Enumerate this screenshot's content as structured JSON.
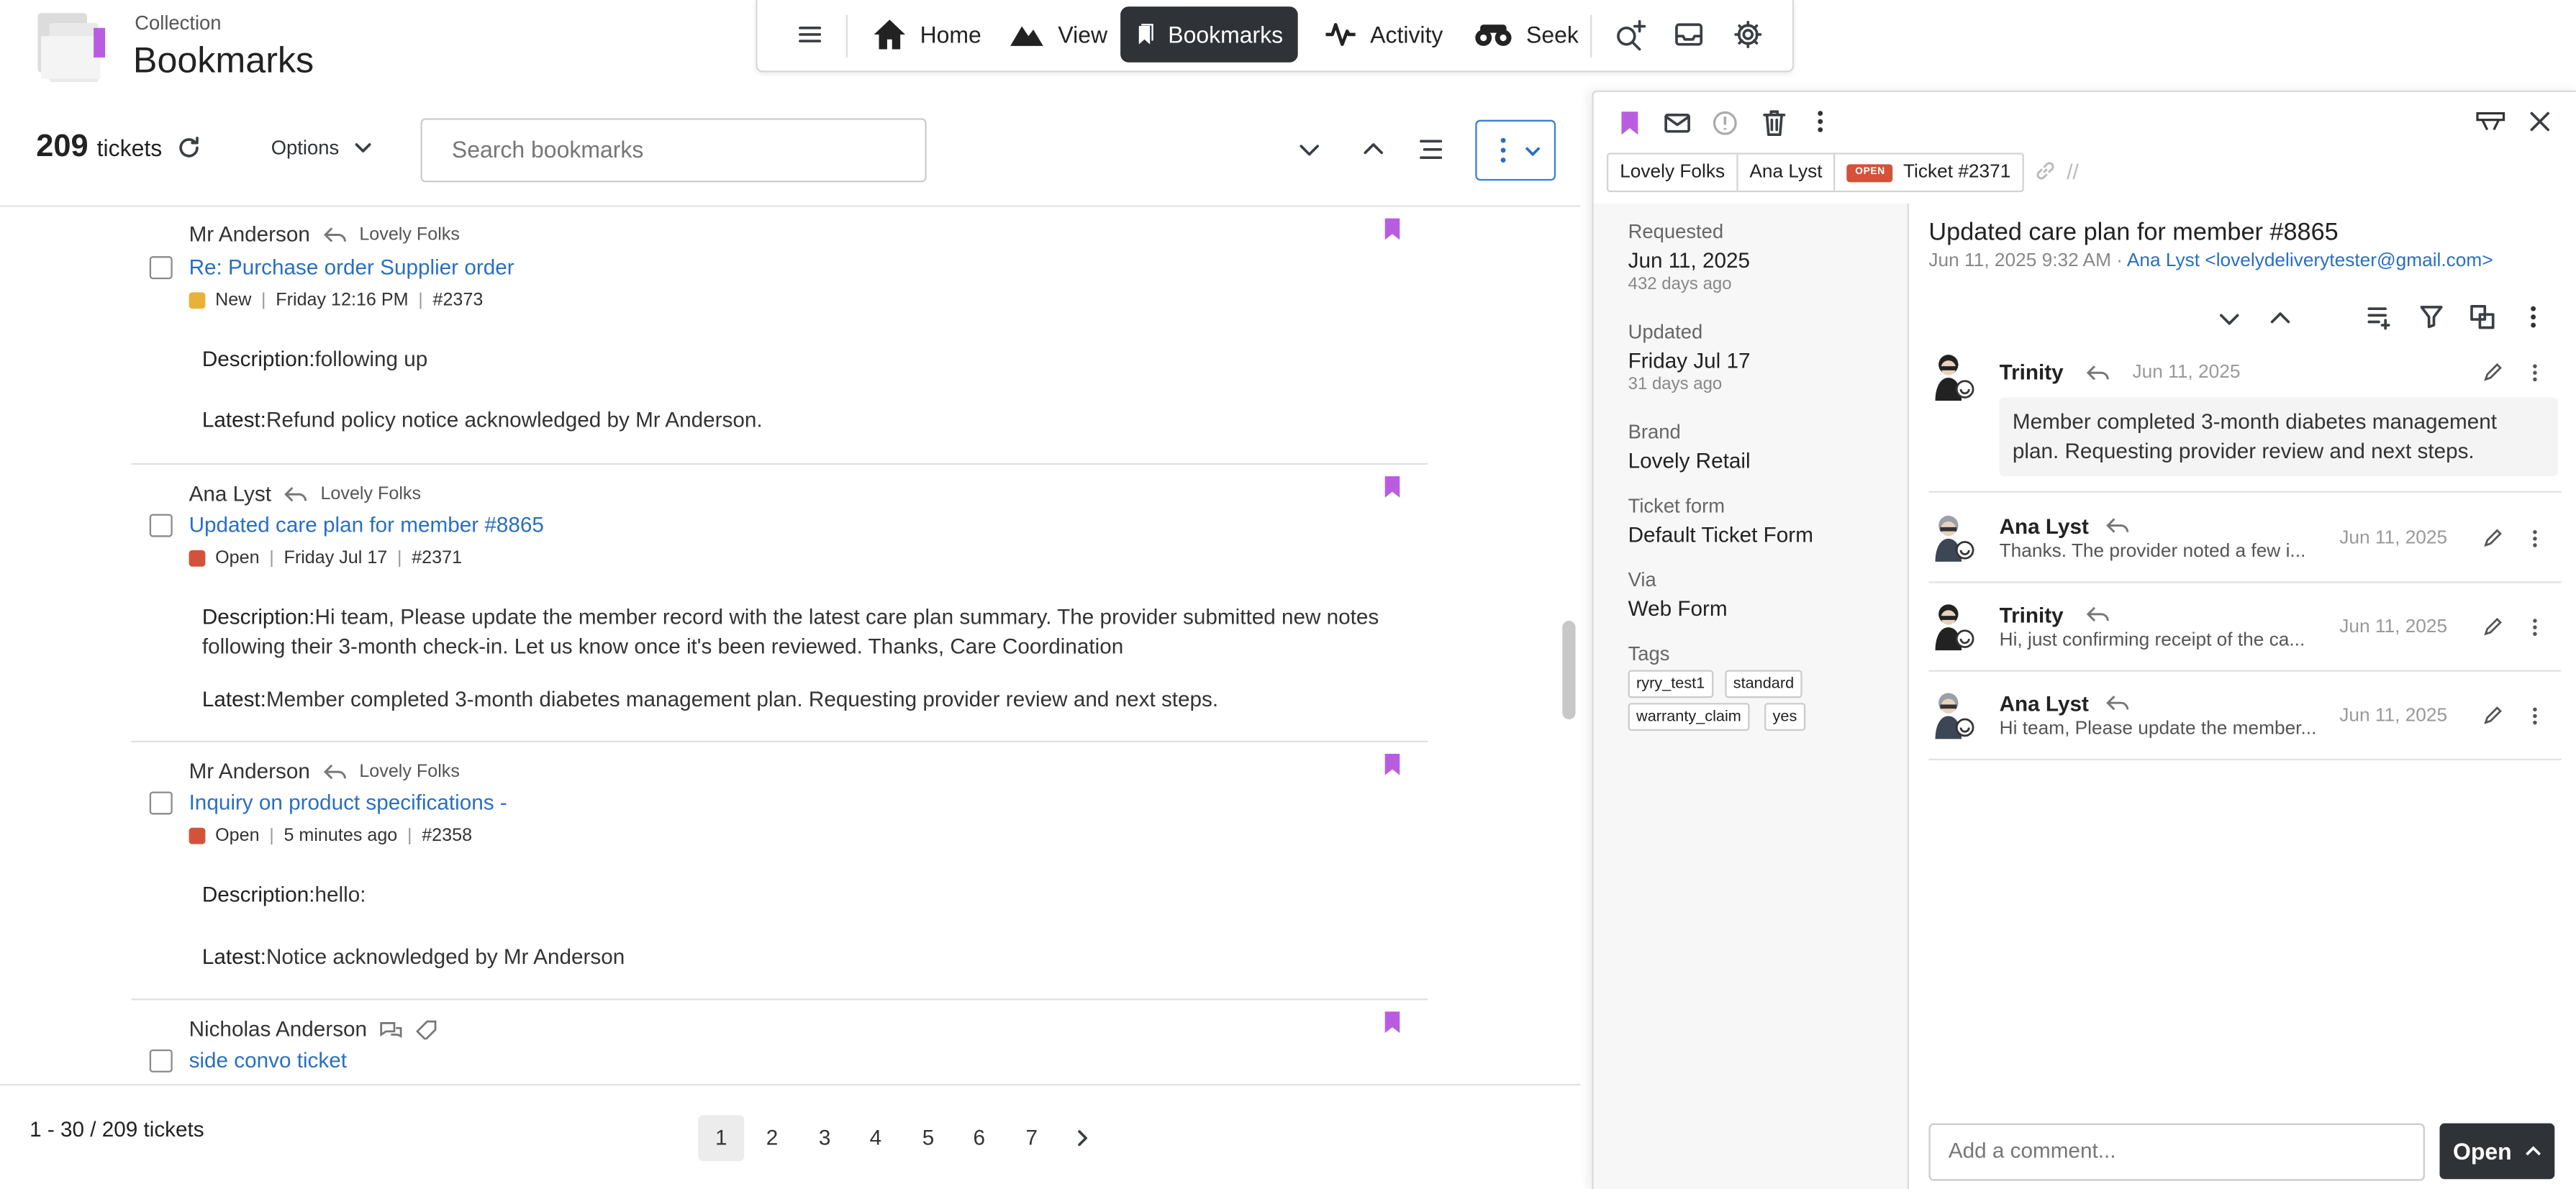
{
  "header": {
    "subtitle": "Collection",
    "title": "Bookmarks"
  },
  "nav": {
    "items": [
      {
        "label": "Home",
        "icon": "home-icon"
      },
      {
        "label": "View",
        "icon": "view-icon"
      },
      {
        "label": "Bookmarks",
        "icon": "bookmarks-icon",
        "active": true
      },
      {
        "label": "Activity",
        "icon": "activity-icon"
      },
      {
        "label": "Seek",
        "icon": "binoculars-icon"
      }
    ]
  },
  "toolbar": {
    "count": "209",
    "count_label": "tickets",
    "options_label": "Options",
    "search_placeholder": "Search bookmarks"
  },
  "tickets": [
    {
      "requester": "Mr Anderson",
      "org": "Lovely Folks",
      "subject": "Re: Purchase order Supplier order",
      "status": "New",
      "status_color": "#e8b23a",
      "date": "Friday 12:16 PM",
      "id": "#2373",
      "desc_label": "Description:",
      "description": "following up",
      "latest_label": "Latest:",
      "latest": "Refund policy notice acknowledged by Mr Anderson."
    },
    {
      "requester": "Ana Lyst",
      "org": "Lovely Folks",
      "subject": "Updated care plan for member #8865",
      "status": "Open",
      "status_color": "#d2533a",
      "date": "Friday Jul 17",
      "id": "#2371",
      "desc_label": "Description:",
      "description": "Hi team, Please update the member record with the latest care plan summary. The provider submitted new notes following their 3-month check-in. Let us know once it's been reviewed. Thanks, Care Coordination",
      "latest_label": "Latest:",
      "latest": "Member completed 3-month diabetes management plan. Requesting provider review and next steps."
    },
    {
      "requester": "Mr Anderson",
      "org": "Lovely Folks",
      "subject": "Inquiry on product specifications -",
      "status": "Open",
      "status_color": "#d2533a",
      "date": "5 minutes ago",
      "id": "#2358",
      "desc_label": "Description:",
      "description": "hello:",
      "latest_label": "Latest:",
      "latest": "Notice acknowledged by Mr Anderson"
    },
    {
      "requester": "Nicholas Anderson",
      "subject": "side convo ticket"
    }
  ],
  "footer": {
    "range": "1 - 30 / 209 tickets",
    "pages": [
      "1",
      "2",
      "3",
      "4",
      "5",
      "6",
      "7"
    ],
    "current_page": "1"
  },
  "panel": {
    "crumbs": {
      "org": "Lovely Folks",
      "user": "Ana Lyst",
      "badge": "OPEN",
      "ticket": "Ticket #2371"
    },
    "fields": {
      "requested_label": "Requested",
      "requested": "Jun 11, 2025",
      "requested_ago": "432 days ago",
      "updated_label": "Updated",
      "updated": "Friday Jul 17",
      "updated_ago": "31 days ago",
      "brand_label": "Brand",
      "brand": "Lovely Retail",
      "form_label": "Ticket form",
      "form": "Default Ticket Form",
      "via_label": "Via",
      "via": "Web Form",
      "tags_label": "Tags",
      "tags": [
        "ryry_test1",
        "standard",
        "warranty_claim",
        "yes"
      ]
    },
    "title": "Updated care plan for member #8865",
    "subline_date": "Jun 11, 2025 9:32 AM",
    "subline_sender": "Ana Lyst <lovelydeliverytester@gmail.com>",
    "messages": [
      {
        "author": "Trinity",
        "date": "Jun 11, 2025",
        "text": "Member completed 3-month diabetes management plan. Requesting provider review and next steps."
      },
      {
        "author": "Ana Lyst",
        "date": "Jun 11, 2025",
        "text": "Thanks. The provider noted a few i..."
      },
      {
        "author": "Trinity",
        "date": "Jun 11, 2025",
        "text": "Hi, just confirming receipt of the ca..."
      },
      {
        "author": "Ana Lyst",
        "date": "Jun 11, 2025",
        "text": "Hi team, Please update the member..."
      }
    ],
    "comment_placeholder": "Add a comment...",
    "submit_label": "Open"
  },
  "colors": {
    "link": "#2a6fc1",
    "bookmark": "#b95de0",
    "dark": "#2f3338",
    "open": "#d2533a",
    "new": "#e8b23a"
  }
}
